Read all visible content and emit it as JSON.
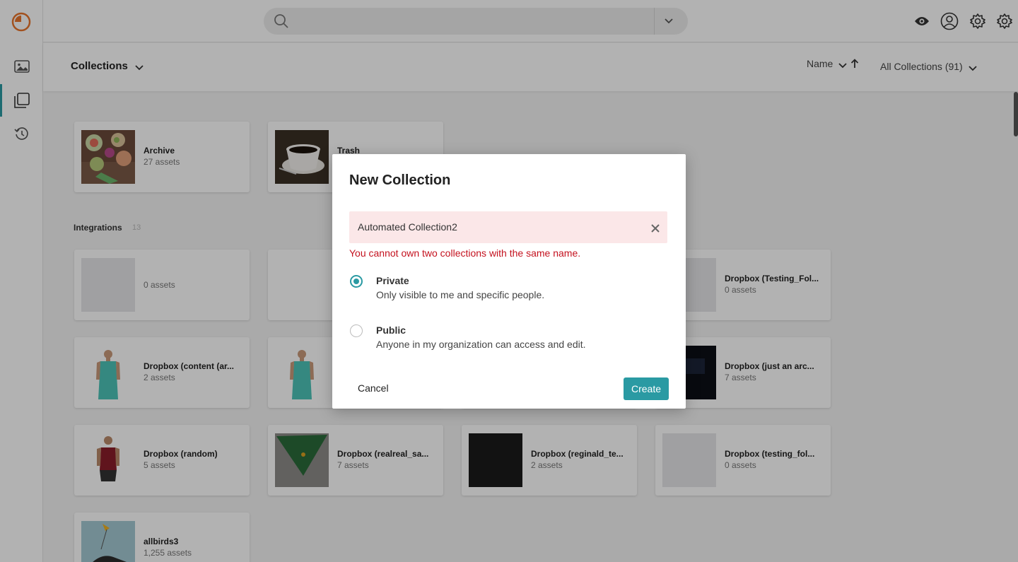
{
  "topbar": {
    "search_placeholder": "",
    "icons": [
      "eye-icon",
      "user-icon",
      "gear-icon",
      "settings-icon"
    ]
  },
  "sidebar": {
    "items": [
      {
        "name": "images",
        "icon": "image-icon",
        "active": false
      },
      {
        "name": "collections",
        "icon": "collections-icon",
        "active": true
      },
      {
        "name": "history",
        "icon": "history-icon",
        "active": false
      }
    ]
  },
  "subheader": {
    "title": "Collections",
    "sort_label": "Name",
    "filter_label": "All Collections (91)"
  },
  "special_collections": [
    {
      "title": "Archive",
      "subtitle": "27 assets"
    },
    {
      "title": "Trash",
      "subtitle": ""
    }
  ],
  "integrations": {
    "label": "Integrations",
    "count": "13",
    "cards": [
      {
        "title": "",
        "subtitle": "0 assets"
      },
      {
        "title": "Dropbox (Testing_Fol...",
        "subtitle": "0 assets"
      },
      {
        "title": "Dropbox (content (ar...",
        "subtitle": "2 assets"
      },
      {
        "title": "Dropbox (just an arc...",
        "subtitle": "7 assets"
      },
      {
        "title": "Dropbox (random)",
        "subtitle": "5 assets"
      },
      {
        "title": "Dropbox (realreal_sa...",
        "subtitle": "7 assets"
      },
      {
        "title": "Dropbox (reginald_te...",
        "subtitle": "2 assets"
      },
      {
        "title": "Dropbox (testing_fol...",
        "subtitle": "0 assets"
      },
      {
        "title": "allbirds3",
        "subtitle": "1,255 assets"
      }
    ]
  },
  "modal": {
    "title": "New Collection",
    "name_value": "Automated Collection2",
    "error": "You cannot own two collections with the same name.",
    "options": [
      {
        "title": "Private",
        "description": "Only visible to me and specific people.",
        "selected": true
      },
      {
        "title": "Public",
        "description": "Anyone in my organization can access and edit.",
        "selected": false
      }
    ],
    "cancel_label": "Cancel",
    "create_label": "Create"
  },
  "colors": {
    "accent": "#2a9aa3",
    "error": "#c4111e",
    "error_field_bg": "#fbe7e8",
    "logo": "#e8742c"
  }
}
